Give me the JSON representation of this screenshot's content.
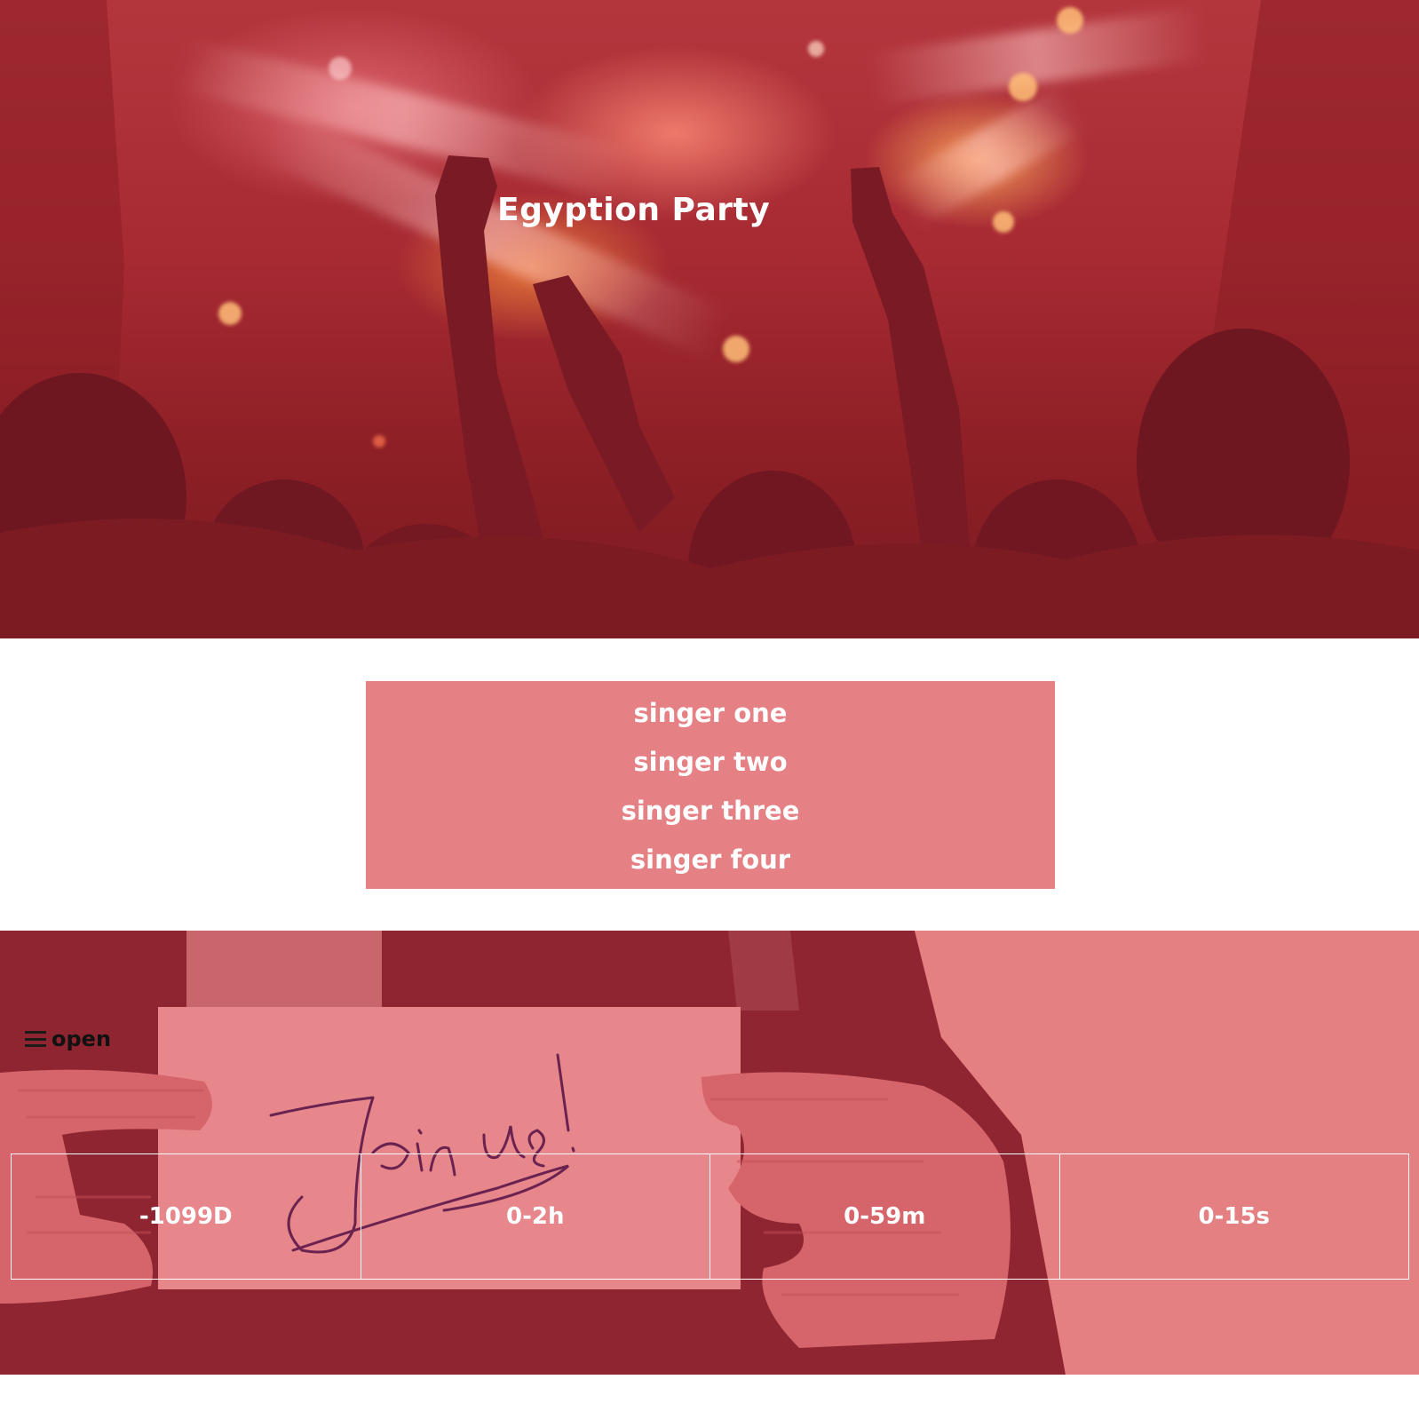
{
  "hero": {
    "title": "Egyption Party"
  },
  "singers": {
    "items": [
      {
        "label": "singer one"
      },
      {
        "label": "singer two"
      },
      {
        "label": "singer three"
      },
      {
        "label": "singer four"
      }
    ]
  },
  "join": {
    "menu_label": "open",
    "menu_icon": "hamburger-icon",
    "sign_text": "Join us!",
    "countdown": [
      {
        "value": "-1099D"
      },
      {
        "value": "0-2h"
      },
      {
        "value": "0-59m"
      },
      {
        "value": "0-15s"
      }
    ]
  },
  "colors": {
    "hero_overlay": "#a72a33",
    "panel_pink": "#e58084",
    "text_white": "#ffffff",
    "menu_text": "#111111"
  }
}
